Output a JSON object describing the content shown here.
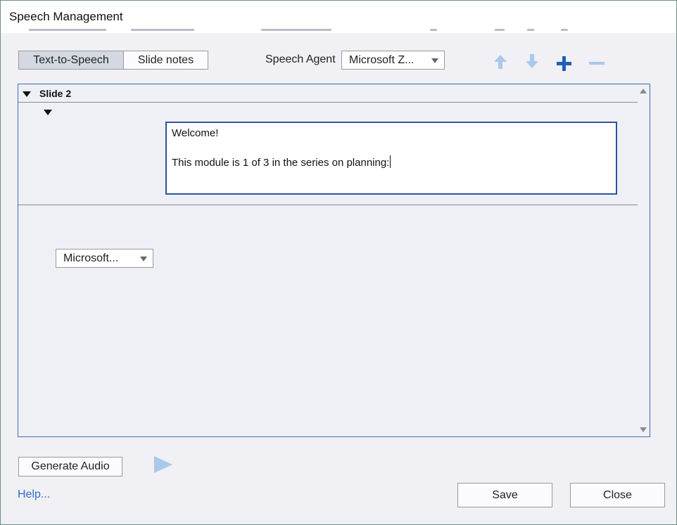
{
  "window": {
    "title": "Speech Management"
  },
  "toolbar": {
    "tabs": [
      {
        "label": "Text-to-Speech",
        "active": true
      },
      {
        "label": "Slide notes",
        "active": false
      }
    ],
    "speech_agent_label": "Speech Agent",
    "speech_agent_value": "Microsoft Z...",
    "icons": [
      "move-up-icon",
      "move-down-icon",
      "add-icon",
      "remove-icon"
    ]
  },
  "panel": {
    "slide_title": "Slide 2",
    "text_lines": [
      "Welcome!",
      "",
      "This module is 1 of 3 in the series on planning:"
    ],
    "voice_select_value": "Microsoft..."
  },
  "footer": {
    "generate_audio_label": "Generate Audio",
    "help_label": "Help...",
    "save_label": "Save",
    "close_label": "Close"
  },
  "colors": {
    "accent": "#2b579a",
    "plus": "#1f5fb4",
    "disabled_arrow": "#a9c8ea",
    "link": "#2f6dc9"
  }
}
